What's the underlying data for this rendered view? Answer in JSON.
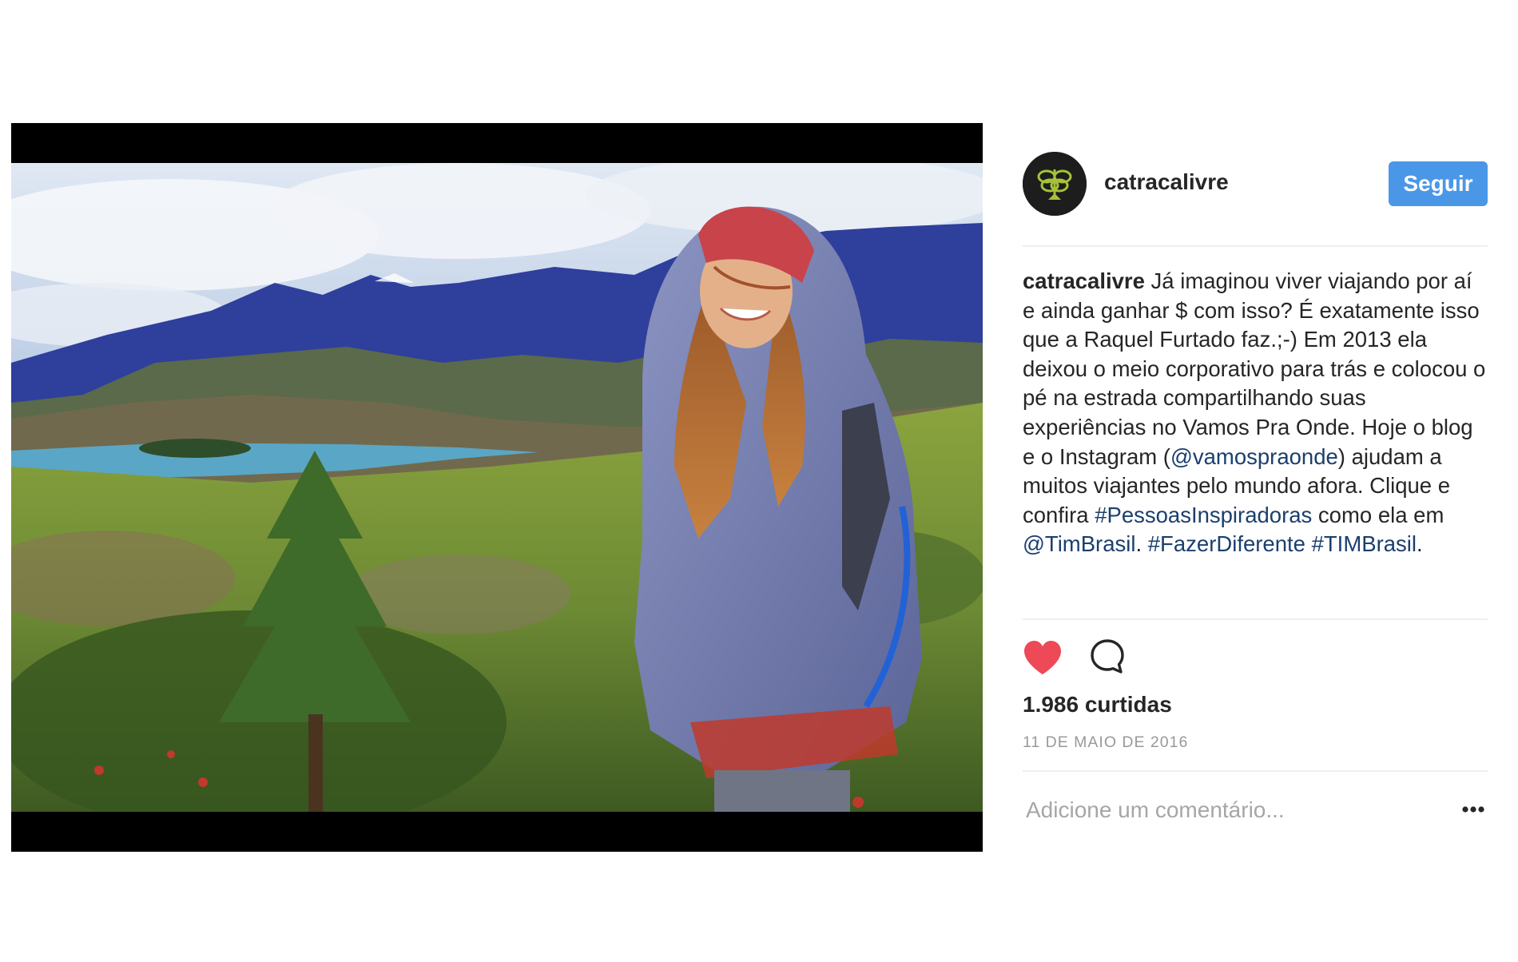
{
  "post": {
    "username": "catracalivre",
    "follow_label": "Seguir",
    "caption": {
      "username": "catracalivre",
      "text_1": " Já imaginou viver viajando por aí e ainda ganhar $ com isso? É exatamente isso que a Raquel Furtado faz.;-) Em 2013 ela deixou o meio corporativo para trás e colocou o pé na estrada compartilhando suas experiências no Vamos Pra Onde. Hoje o blog e o Instagram (",
      "mention_1": "@vamospraonde",
      "text_2": ") ajudam a muitos viajantes pelo mundo afora. Clique e confira ",
      "hashtag_1": "#PessoasInspiradoras",
      "text_3": " como ela em ",
      "mention_2": "@TimBrasil",
      "text_4": ". ",
      "hashtag_2": "#FazerDiferente",
      "text_5": " ",
      "hashtag_3": "#TIMBrasil",
      "text_6": "."
    },
    "likes_count": "1.986",
    "likes_label": "curtidas",
    "date": "11 DE MAIO DE 2016",
    "comment_placeholder": "Adicione um comentário...",
    "more_label": "•••",
    "liked": true
  },
  "icons": {
    "like": "heart-icon",
    "comment": "speech-bubble-icon",
    "more": "ellipsis-icon",
    "avatar": "catraca-logo-icon"
  },
  "colors": {
    "follow_button": "#4a97e8",
    "heart": "#ed4956",
    "link": "#1b3f6e",
    "muted": "#999999",
    "avatar_bg": "#1d1d1d",
    "avatar_logo": "#a6c23a"
  }
}
